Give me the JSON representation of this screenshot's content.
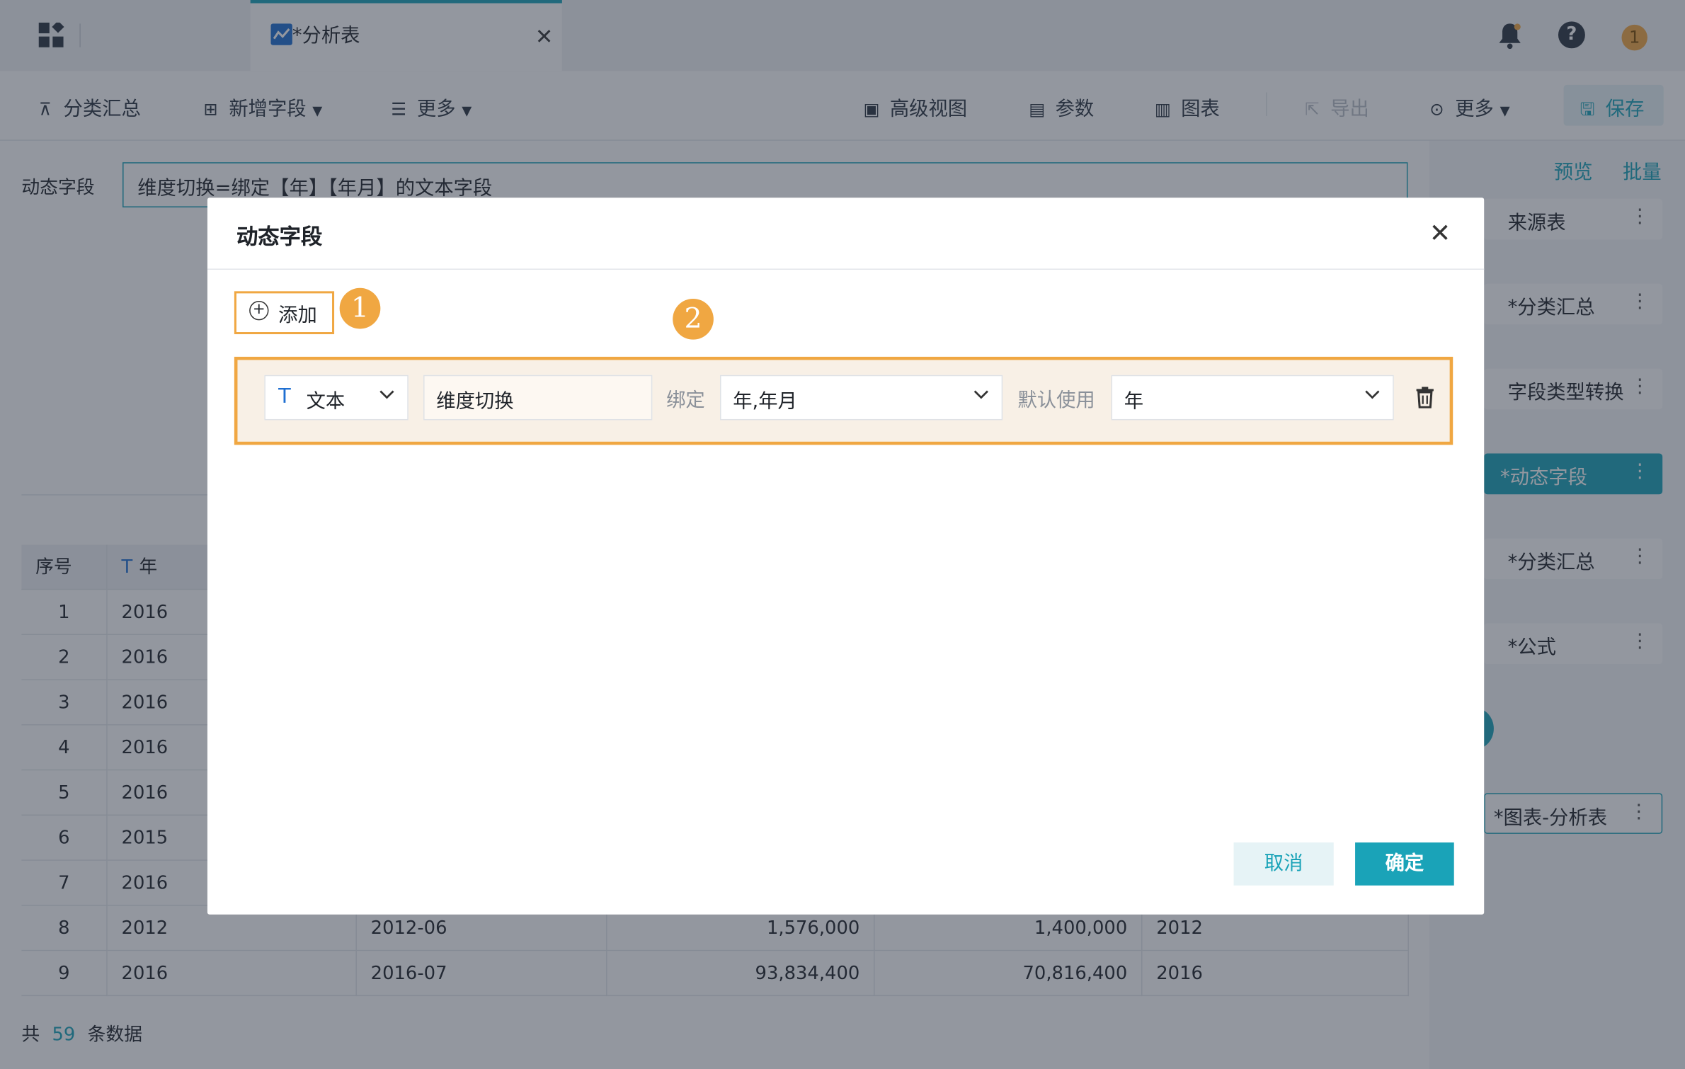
{
  "tab": {
    "title": "*分析表"
  },
  "toolbar": {
    "group_summary": "分类汇总",
    "add_field": "新增字段",
    "more_left": "更多",
    "advanced_view": "高级视图",
    "params": "参数",
    "chart": "图表",
    "export": "导出",
    "more_right": "更多",
    "save": "保存"
  },
  "editor": {
    "label": "动态字段",
    "formula": "维度切换=绑定【年】【年月】的文本字段"
  },
  "table": {
    "headers": [
      "序号",
      "年"
    ],
    "rows": [
      [
        "1",
        "2016",
        "",
        "",
        "",
        ""
      ],
      [
        "2",
        "2016",
        "",
        "",
        "",
        ""
      ],
      [
        "3",
        "2016",
        "",
        "",
        "",
        ""
      ],
      [
        "4",
        "2016",
        "",
        "",
        "",
        ""
      ],
      [
        "5",
        "2016",
        "",
        "",
        "",
        ""
      ],
      [
        "6",
        "2015",
        "",
        "",
        "",
        ""
      ],
      [
        "7",
        "2016",
        "",
        "",
        "",
        ""
      ],
      [
        "8",
        "2012",
        "2012-06",
        "1,576,000",
        "1,400,000",
        "2012"
      ],
      [
        "9",
        "2016",
        "2016-07",
        "93,834,400",
        "70,816,400",
        "2016"
      ]
    ],
    "total_prefix": "共",
    "total_count": "59",
    "total_suffix": "条数据"
  },
  "right_panel": {
    "preview": "预览",
    "batch": "批量",
    "nodes": [
      "来源表",
      "*分类汇总",
      "字段类型转换",
      "*动态字段",
      "*分类汇总",
      "*公式",
      "*图表-分析表"
    ]
  },
  "dialog": {
    "title": "动态字段",
    "add_label": "添加",
    "badge1": "1",
    "badge2": "2",
    "type_value": "文本",
    "name_value": "维度切换",
    "bind_label": "绑定",
    "bind_value": "年,年月",
    "default_label": "默认使用",
    "default_value": "年",
    "cancel": "取消",
    "ok": "确定"
  },
  "colors": {
    "accent": "#1aa3b8",
    "highlight": "#f0a742"
  }
}
